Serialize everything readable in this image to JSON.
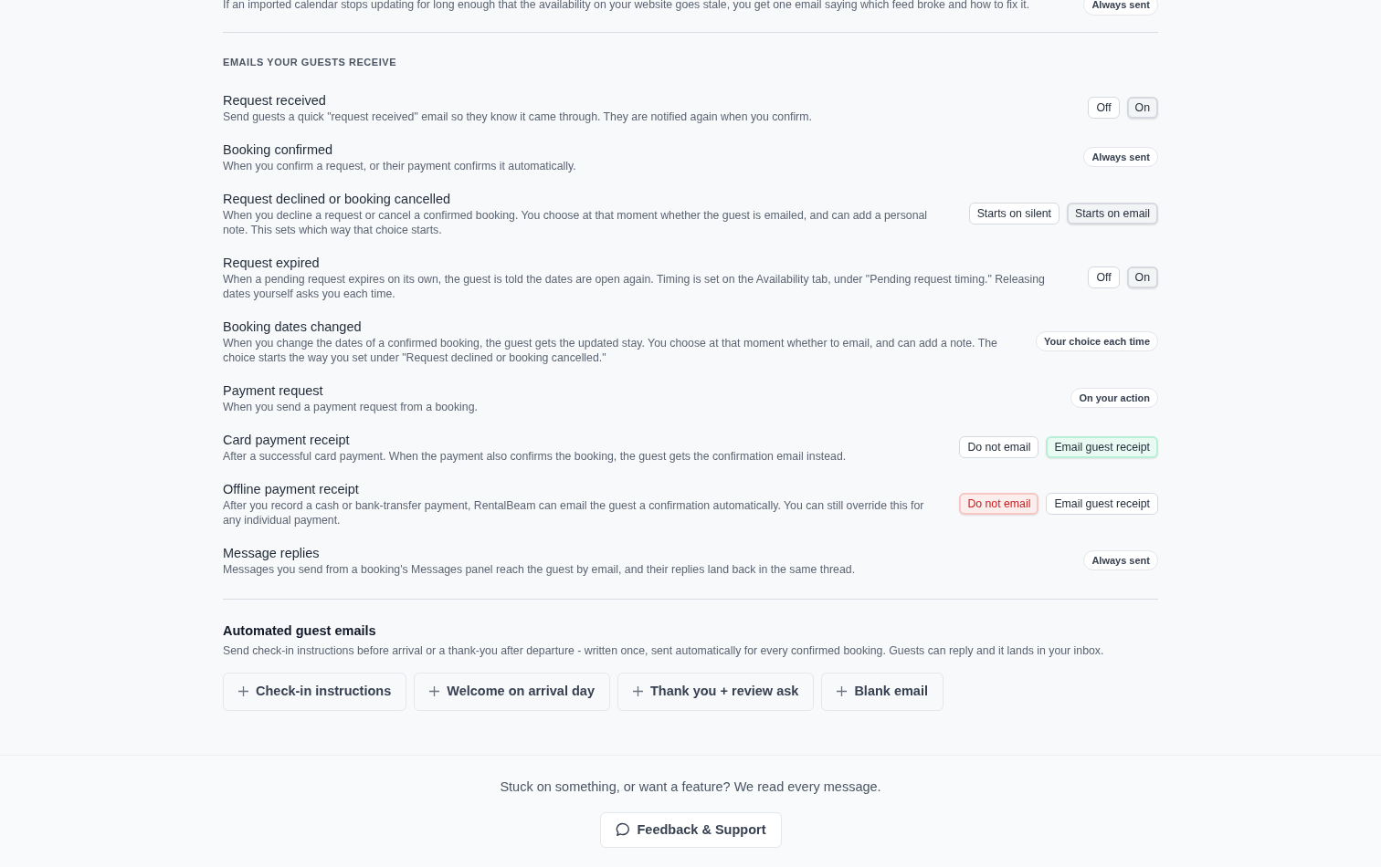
{
  "top_item": {
    "description": "If an imported calendar stops updating for long enough that the availability on your website goes stale, you get one email saying which feed broke and how to fix it.",
    "badge": "Always sent"
  },
  "guest_emails": {
    "heading": "EMAILS YOUR GUESTS RECEIVE",
    "rows": [
      {
        "kind": "toggle",
        "title": "Request received",
        "description": "Send guests a quick \"request received\" email so they know it came through. They are notified again when you confirm.",
        "options": [
          {
            "label": "Off",
            "selected": false
          },
          {
            "label": "On",
            "selected": true,
            "color": "#d5d9df"
          }
        ]
      },
      {
        "kind": "badge",
        "title": "Booking confirmed",
        "description": "When you confirm a request, or their payment confirms it automatically.",
        "badge": "Always sent"
      },
      {
        "kind": "toggle",
        "title": "Request declined or booking cancelled",
        "description": "When you decline a request or cancel a confirmed booking. You choose at that moment whether the guest is emailed, and can add a personal note. This sets which way that choice starts.",
        "options": [
          {
            "label": "Starts on silent",
            "selected": false
          },
          {
            "label": "Starts on email",
            "selected": true,
            "color": "#d5d9df"
          }
        ]
      },
      {
        "kind": "toggle",
        "title": "Request expired",
        "description": "When a pending request expires on its own, the guest is told the dates are open again. Timing is set on the Availability tab, under \"Pending request timing.\" Releasing dates yourself asks you each time.",
        "options": [
          {
            "label": "Off",
            "selected": false
          },
          {
            "label": "On",
            "selected": true,
            "color": "#d5d9df"
          }
        ]
      },
      {
        "kind": "badge",
        "title": "Booking dates changed",
        "description": "When you change the dates of a confirmed booking, the guest gets the updated stay. You choose at that moment whether to email, and can add a note. The choice starts the way you set under \"Request declined or booking cancelled.\"",
        "badge": "Your choice each time"
      },
      {
        "kind": "badge",
        "title": "Payment request",
        "description": "When you send a payment request from a booking.",
        "badge": "On your action"
      },
      {
        "kind": "toggle",
        "title": "Card payment receipt",
        "description": "After a successful card payment. When the payment also confirms the booking, the guest gets the confirmation email instead.",
        "options": [
          {
            "label": "Do not email",
            "selected": false
          },
          {
            "label": "Email guest receipt",
            "selected": true,
            "color": "#b7efd7"
          }
        ]
      },
      {
        "kind": "toggle",
        "title": "Offline payment receipt",
        "description": "After you record a cash or bank-transfer payment, RentalBeam can email the guest a confirmation automatically. You can still override this for any individual payment.",
        "options": [
          {
            "label": "Do not email",
            "selected": true,
            "color": "#f8c5c5"
          },
          {
            "label": "Email guest receipt",
            "selected": false
          }
        ]
      },
      {
        "kind": "badge",
        "title": "Message replies",
        "description": "Messages you send from a booking's Messages panel reach the guest by email, and their replies land back in the same thread.",
        "badge": "Always sent"
      }
    ]
  },
  "automated": {
    "title": "Automated guest emails",
    "description": "Send check-in instructions before arrival or a thank-you after departure - written once, sent automatically for every confirmed booking. Guests can reply and it lands in your inbox.",
    "templates": [
      "Check-in instructions",
      "Welcome on arrival day",
      "Thank you + review ask",
      "Blank email"
    ]
  },
  "footer": {
    "text": "Stuck on something, or want a feature? We read every message.",
    "button": "Feedback & Support"
  }
}
